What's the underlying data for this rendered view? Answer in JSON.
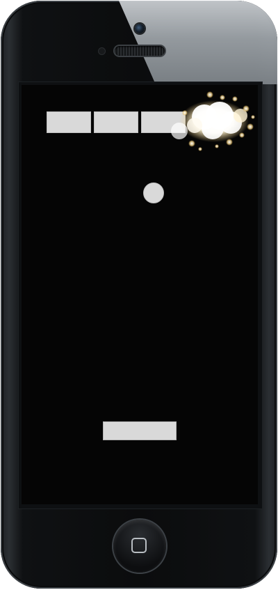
{
  "game": {
    "name": "Breakout",
    "colors": {
      "brick": "#d9d9d9",
      "ball": "#d9d9d9",
      "paddle": "#d9d9d9",
      "background": "#050505",
      "explosion": "#fff6d8"
    },
    "bricks": [
      {
        "id": "brick-1",
        "destroyed": false
      },
      {
        "id": "brick-2",
        "destroyed": false
      },
      {
        "id": "brick-3",
        "destroyed": false
      },
      {
        "id": "brick-4",
        "destroyed": true
      }
    ],
    "effects": [
      {
        "type": "explosion",
        "state": "active"
      }
    ]
  },
  "device": {
    "model": "smartphone",
    "home_button_icon": "square-home-icon"
  }
}
